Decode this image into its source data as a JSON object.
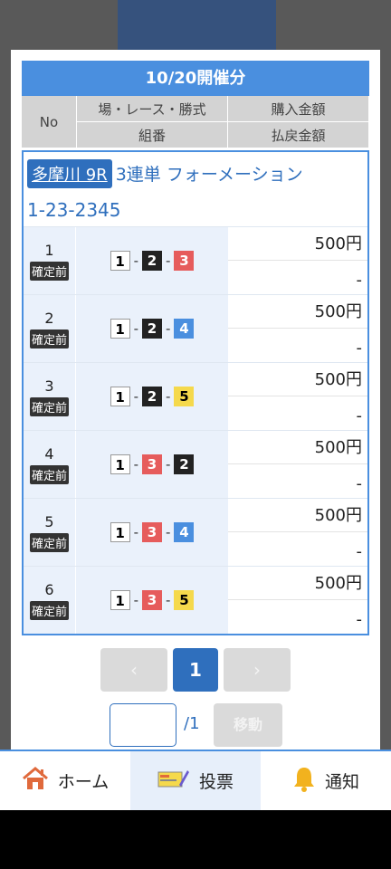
{
  "header": {
    "title": "10/20開催分",
    "col_no": "No",
    "col_race": "場・レース・勝式",
    "col_combo": "組番",
    "col_buy": "購入金額",
    "col_payout": "払戻金額"
  },
  "card": {
    "venue": "多摩川 9R",
    "bet_type": "3連単 フォーメーション",
    "combination": "1-23-2345"
  },
  "rows": [
    {
      "no": "1",
      "status": "確定前",
      "nums": [
        "1",
        "2",
        "3"
      ],
      "amount": "500円",
      "payout": "-"
    },
    {
      "no": "2",
      "status": "確定前",
      "nums": [
        "1",
        "2",
        "4"
      ],
      "amount": "500円",
      "payout": "-"
    },
    {
      "no": "3",
      "status": "確定前",
      "nums": [
        "1",
        "2",
        "5"
      ],
      "amount": "500円",
      "payout": "-"
    },
    {
      "no": "4",
      "status": "確定前",
      "nums": [
        "1",
        "3",
        "2"
      ],
      "amount": "500円",
      "payout": "-"
    },
    {
      "no": "5",
      "status": "確定前",
      "nums": [
        "1",
        "3",
        "4"
      ],
      "amount": "500円",
      "payout": "-"
    },
    {
      "no": "6",
      "status": "確定前",
      "nums": [
        "1",
        "3",
        "5"
      ],
      "amount": "500円",
      "payout": "-"
    }
  ],
  "pager": {
    "prev": "‹",
    "current": "1",
    "next": "›"
  },
  "jump": {
    "input_value": "",
    "total": "/1",
    "move_label": "移動"
  },
  "tabs": [
    {
      "label": "ホーム",
      "icon": "home-icon"
    },
    {
      "label": "投票",
      "icon": "ticket-icon"
    },
    {
      "label": "通知",
      "icon": "bell-icon"
    }
  ],
  "colors": {
    "accent": "#4a8fdf",
    "brand": "#2f6fbd",
    "boat1": "#ffffff",
    "boat2": "#222222",
    "boat3": "#e65c5c",
    "boat4": "#4a8fdf",
    "boat5": "#f5d94c"
  }
}
